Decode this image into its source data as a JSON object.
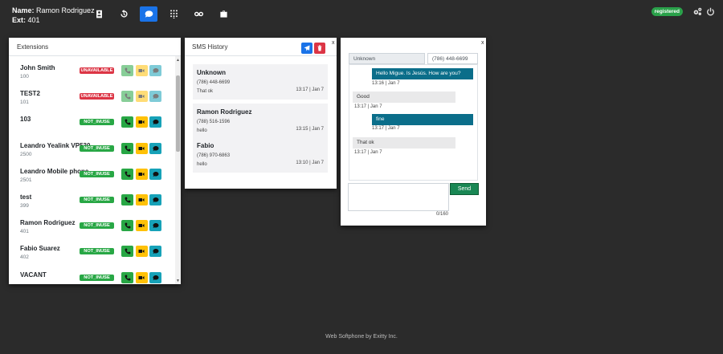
{
  "user": {
    "name_label": "Name:",
    "name": "Ramon Rodriguez",
    "ext_label": "Ext:",
    "ext": "401"
  },
  "nav": [
    {
      "icon": "contacts-book-icon",
      "active": false
    },
    {
      "icon": "history-icon",
      "active": false
    },
    {
      "icon": "chat-bubble-icon",
      "active": true
    },
    {
      "icon": "dialpad-icon",
      "active": false
    },
    {
      "icon": "voicemail-icon",
      "active": false
    },
    {
      "icon": "briefcase-icon",
      "active": false
    }
  ],
  "status_badge": "registered",
  "extensions": {
    "title": "Extensions",
    "items": [
      {
        "name": "John Smith",
        "number": "100",
        "status": "UNAVAILABLE"
      },
      {
        "name": "TEST2",
        "number": "101",
        "status": "UNAVAILABLE"
      },
      {
        "name": "103",
        "number": "",
        "status": "NOT_INUSE"
      },
      {
        "name": "Leandro Yealink VP530",
        "number": "2500",
        "status": "NOT_INUSE"
      },
      {
        "name": "Leandro Mobile phone",
        "number": "2501",
        "status": "NOT_INUSE"
      },
      {
        "name": "test",
        "number": "399",
        "status": "NOT_INUSE"
      },
      {
        "name": "Ramon Rodriguez",
        "number": "401",
        "status": "NOT_INUSE"
      },
      {
        "name": "Fabio Suarez",
        "number": "402",
        "status": "NOT_INUSE"
      },
      {
        "name": "VACANT",
        "number": "",
        "status": "NOT_INUSE"
      }
    ]
  },
  "sms_history": {
    "title": "SMS History",
    "close": "x",
    "items": [
      {
        "name": "Unknown",
        "phone": "(786) 448-6699",
        "text": "That ok",
        "time": "13:17 | Jan 7"
      },
      {
        "name": "Ramon Rodriguez",
        "phone": "(788) 516-1596",
        "text": "hello",
        "time": "13:15 | Jan 7"
      },
      {
        "name": "Fabio",
        "phone": "(786) 970-6863",
        "text": "hello",
        "time": "13:10 | Jan 7"
      }
    ]
  },
  "chat": {
    "close": "x",
    "contact_name": "Unknown",
    "contact_phone": "(786) 448-6699",
    "messages": [
      {
        "dir": "out",
        "text": "Hello Migue. Is Jesús. How are you?",
        "time": "13:16 | Jan 7"
      },
      {
        "dir": "in",
        "text": "Good",
        "time": "13:17 | Jan 7"
      },
      {
        "dir": "out",
        "text": "fine",
        "time": "13:17 | Jan 7"
      },
      {
        "dir": "in",
        "text": "That ok",
        "time": "13:17 | Jan 7"
      }
    ],
    "counter": "0/160",
    "send_label": "Send"
  },
  "footer": "Web Softphone by Exitty Inc."
}
